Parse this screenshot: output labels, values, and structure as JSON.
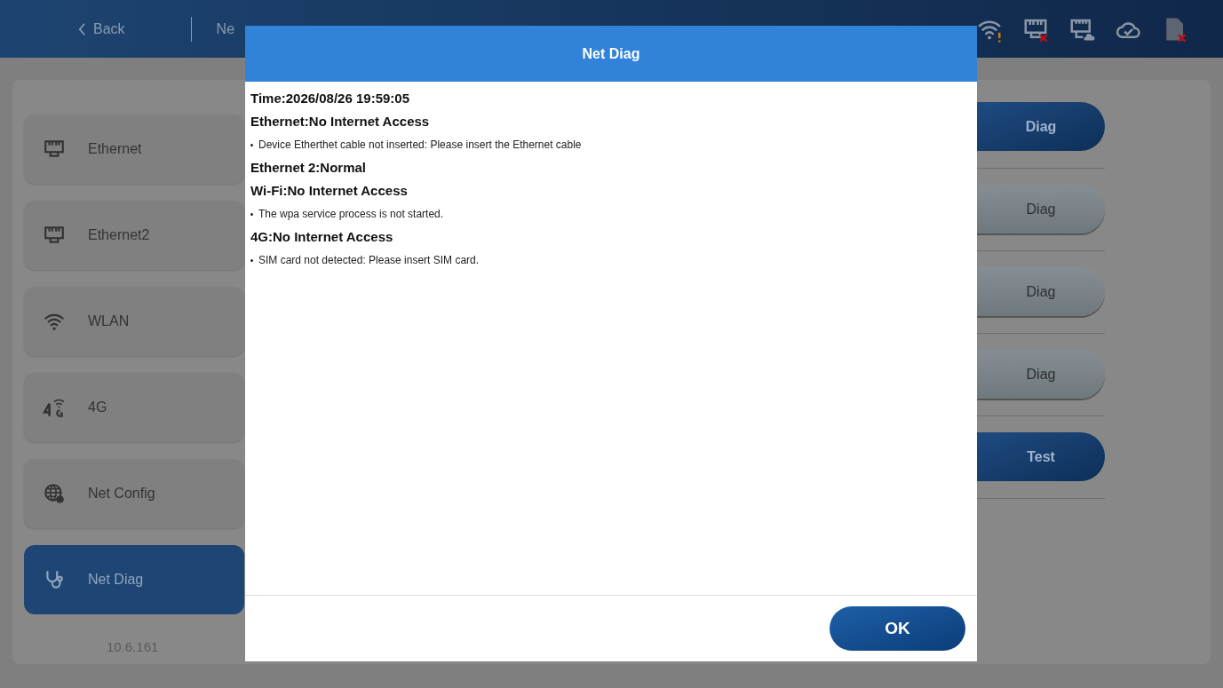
{
  "header": {
    "back": "Back",
    "title": "Ne",
    "status_icons": [
      {
        "kind": "wifi_warning"
      },
      {
        "kind": "ethernet_error"
      },
      {
        "kind": "ethernet_cloud"
      },
      {
        "kind": "cloud_check"
      },
      {
        "kind": "sdcard_error"
      }
    ]
  },
  "sidebar": {
    "items": [
      {
        "kind": "ethernet",
        "label": "Ethernet",
        "selected": false
      },
      {
        "kind": "ethernet",
        "label": "Ethernet2",
        "selected": false
      },
      {
        "kind": "wifi",
        "label": "WLAN",
        "selected": false
      },
      {
        "kind": "cellular",
        "label": "4G",
        "selected": false
      },
      {
        "kind": "globe",
        "label": "Net Config",
        "selected": false
      },
      {
        "kind": "stethoscope",
        "label": "Net Diag",
        "selected": true
      }
    ],
    "version": "10.6.161"
  },
  "actions": [
    {
      "label": "Diag",
      "kind": "primary"
    },
    {
      "label": "Diag",
      "kind": "secondary"
    },
    {
      "label": "Diag",
      "kind": "secondary"
    },
    {
      "label": "Diag",
      "kind": "secondary"
    },
    {
      "label": "Test",
      "kind": "primary"
    }
  ],
  "dialog": {
    "title": "Net Diag",
    "lines": [
      {
        "kind": "heading",
        "text": "Time:2026/08/26 19:59:05"
      },
      {
        "kind": "heading",
        "text": "Ethernet:No Internet Access"
      },
      {
        "kind": "bullet",
        "text": "Device Etherthet cable not inserted: Please insert the Ethernet cable"
      },
      {
        "kind": "heading",
        "text": "Ethernet 2:Normal"
      },
      {
        "kind": "heading",
        "text": "Wi-Fi:No Internet Access"
      },
      {
        "kind": "bullet",
        "text": "The wpa service process is not started."
      },
      {
        "kind": "heading",
        "text": "4G:No Internet Access"
      },
      {
        "kind": "bullet",
        "text": "SIM card not detected: Please insert SIM card."
      }
    ],
    "button": "OK"
  }
}
